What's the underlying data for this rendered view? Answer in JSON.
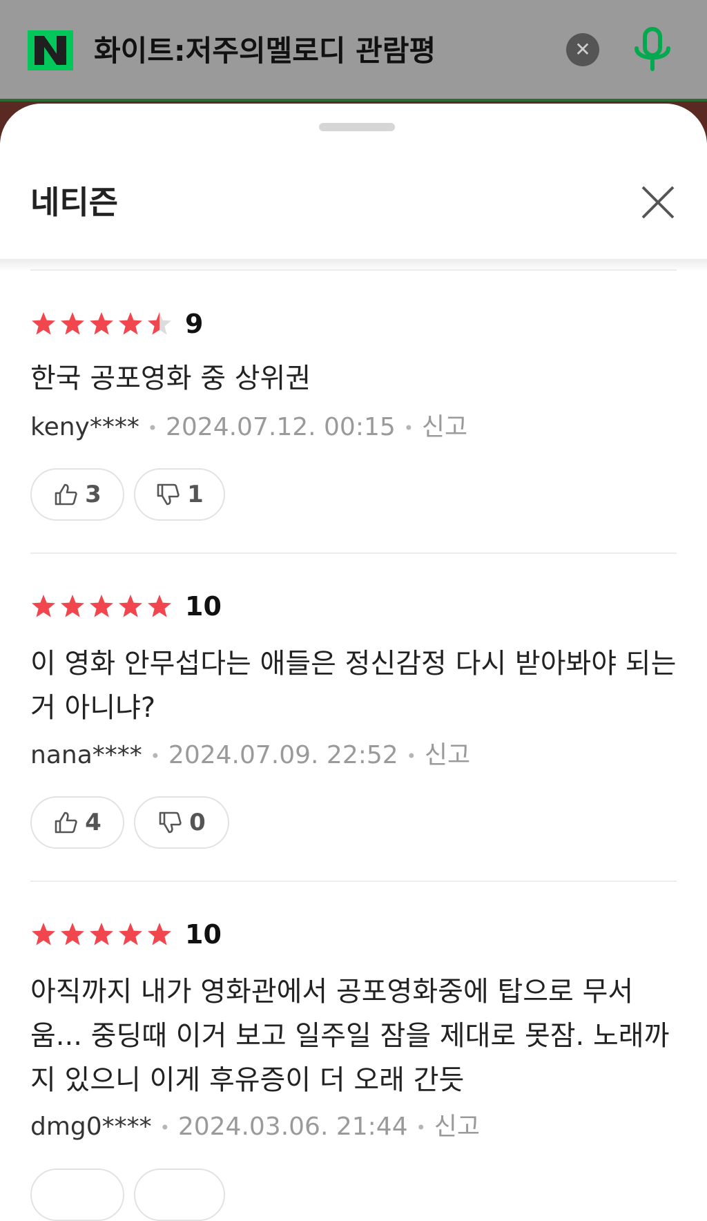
{
  "search": {
    "query": "화이트:저주의멜로디 관람평",
    "clear_icon": "close-circle-icon",
    "mic_icon": "microphone-icon",
    "brand_color": "#03c75a"
  },
  "sheet": {
    "title": "네티즌"
  },
  "reviews": [
    {
      "rating": 4.5,
      "score": "9",
      "text": "한국 공포영화 중 상위권",
      "user": "keny****",
      "date": "2024.07.12. 00:15",
      "report": "신고",
      "likes": "3",
      "dislikes": "1"
    },
    {
      "rating": 5,
      "score": "10",
      "text": "이 영화 안무섭다는 애들은 정신감정 다시 받아봐야 되는거 아니냐?",
      "user": "nana****",
      "date": "2024.07.09. 22:52",
      "report": "신고",
      "likes": "4",
      "dislikes": "0"
    },
    {
      "rating": 5,
      "score": "10",
      "text": "아직까지 내가 영화관에서 공포영화중에 탑으로 무서움... 중딩때 이거 보고 일주일 잠을 제대로 못잠. 노래까지 있으니 이게 후유증이 더 오래 간듯",
      "user": "dmg0****",
      "date": "2024.03.06. 21:44",
      "report": "신고",
      "likes": "",
      "dislikes": ""
    }
  ],
  "colors": {
    "star": "#f2464e",
    "star_empty": "#dcdcdc"
  }
}
